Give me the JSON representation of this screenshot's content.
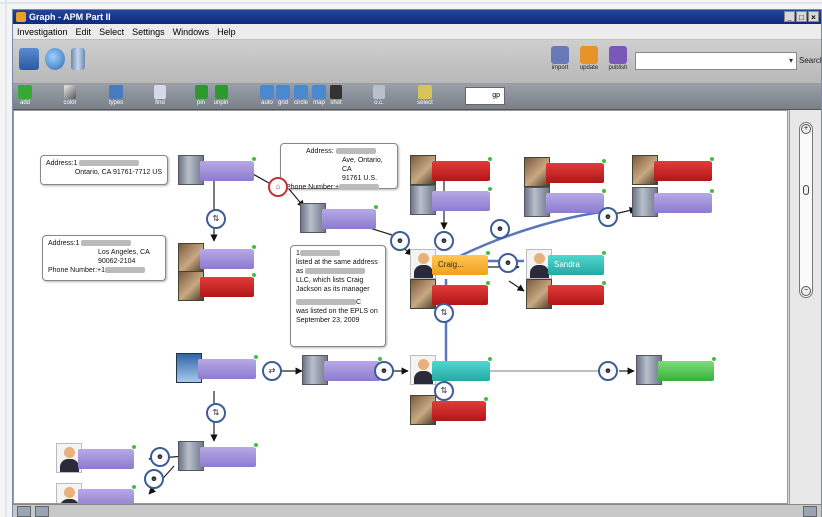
{
  "window": {
    "title": "Graph - APM Part II",
    "controls": [
      "_",
      "□",
      "×"
    ]
  },
  "menu": [
    "Investigation",
    "Edit",
    "Select",
    "Settings",
    "Windows",
    "Help"
  ],
  "toolbar_top": {
    "right_buttons": [
      {
        "label": "import",
        "icon": "import-icon",
        "color": "#6a7ab8"
      },
      {
        "label": "update",
        "icon": "update-icon",
        "color": "#e8922a"
      },
      {
        "label": "publish",
        "icon": "publish-icon",
        "color": "#7a58b8"
      }
    ],
    "search_placeholder": "",
    "search_button": "Search"
  },
  "toolbar_graph": {
    "buttons": [
      {
        "label": "add",
        "icon": "add-icon"
      },
      {
        "label": "color",
        "icon": "color-icon"
      },
      {
        "label": "types",
        "icon": "types-icon"
      },
      {
        "label": "find",
        "icon": "find-icon"
      },
      {
        "label": "pin",
        "icon": "pin-icon"
      },
      {
        "label": "unpin",
        "icon": "unpin-icon"
      },
      {
        "label": "auto",
        "icon": "auto-layout-icon"
      },
      {
        "label": "grid",
        "icon": "grid-layout-icon"
      },
      {
        "label": "circle",
        "icon": "circle-layout-icon"
      },
      {
        "label": "map",
        "icon": "map-icon"
      },
      {
        "label": "shot",
        "icon": "camera-icon"
      },
      {
        "label": "o.c.",
        "icon": "oc-icon"
      },
      {
        "label": "select",
        "icon": "select-icon"
      }
    ],
    "field_value": "gp"
  },
  "callouts": {
    "address1": {
      "line1": "Address:1",
      "line2": "Ontario, CA 91761-7712 US"
    },
    "address2": {
      "line1": "Address:1",
      "line2": "Los Angeles, CA",
      "line3": "90062-2104",
      "line4": "Phone Number:+1"
    },
    "address3": {
      "line1": "Address:",
      "line2": "Ave, Ontario, CA",
      "line3": "91761 U.S.",
      "line4": "Phone Number:+"
    },
    "note": {
      "line1": "1",
      "line2": "listed at the same address",
      "line3": "as",
      "line4": "LLC, which lists Craig",
      "line5": "Jackson as its manager",
      "line6": "C",
      "line7": "was listed on the EPLS on",
      "line8": "September 23, 2009"
    }
  },
  "nodes": {
    "craig": "Craig...",
    "sandra": "Sandra"
  },
  "colors": {
    "edge": "#5a78b8",
    "edge_dark": "#222222",
    "alert": "#c81e1e",
    "person_node": "#2fb5ae",
    "selected_node": "#f2a51c",
    "entity_node": "#9d8fdb"
  }
}
